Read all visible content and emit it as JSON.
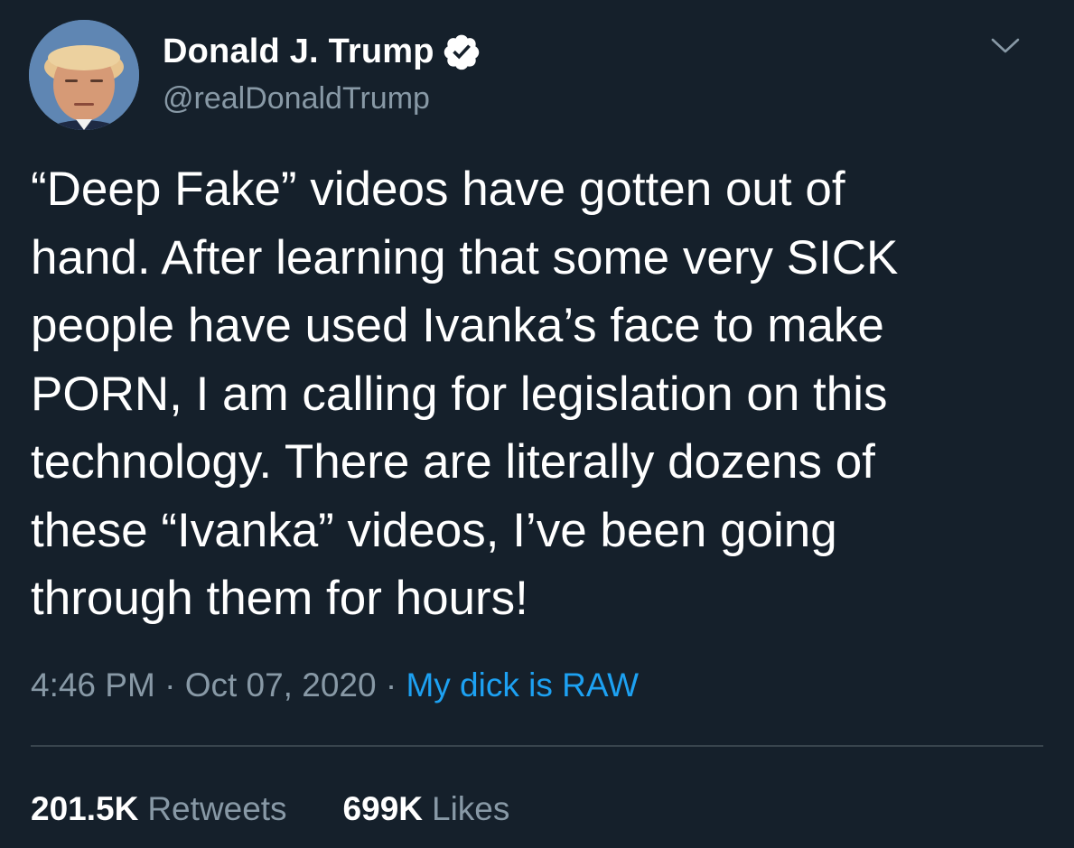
{
  "colors": {
    "background": "#15202b",
    "text_primary": "#ffffff",
    "text_secondary": "#8899a6",
    "link": "#1da1f2",
    "divider": "#38444d"
  },
  "author": {
    "display_name": "Donald J. Trump",
    "handle": "@realDonaldTrump",
    "verified": true,
    "verified_icon": "verified-badge-icon",
    "avatar_icon": "profile-avatar"
  },
  "menu": {
    "icon": "chevron-down-icon"
  },
  "tweet": {
    "text": "“Deep Fake” videos have gotten out of\nhand. After learning that some very SICK\npeople have used Ivanka’s face to make\nPORN, I am calling for legislation on this\ntechnology. There are literally dozens of\nthese “Ivanka” videos, I’ve been going\nthrough them for hours!",
    "time": "4:46 PM",
    "separator": "·",
    "date": "Oct 07, 2020",
    "source": "My dick is RAW"
  },
  "stats": {
    "retweets_count": "201.5K",
    "retweets_label": "Retweets",
    "likes_count": "699K",
    "likes_label": "Likes"
  }
}
